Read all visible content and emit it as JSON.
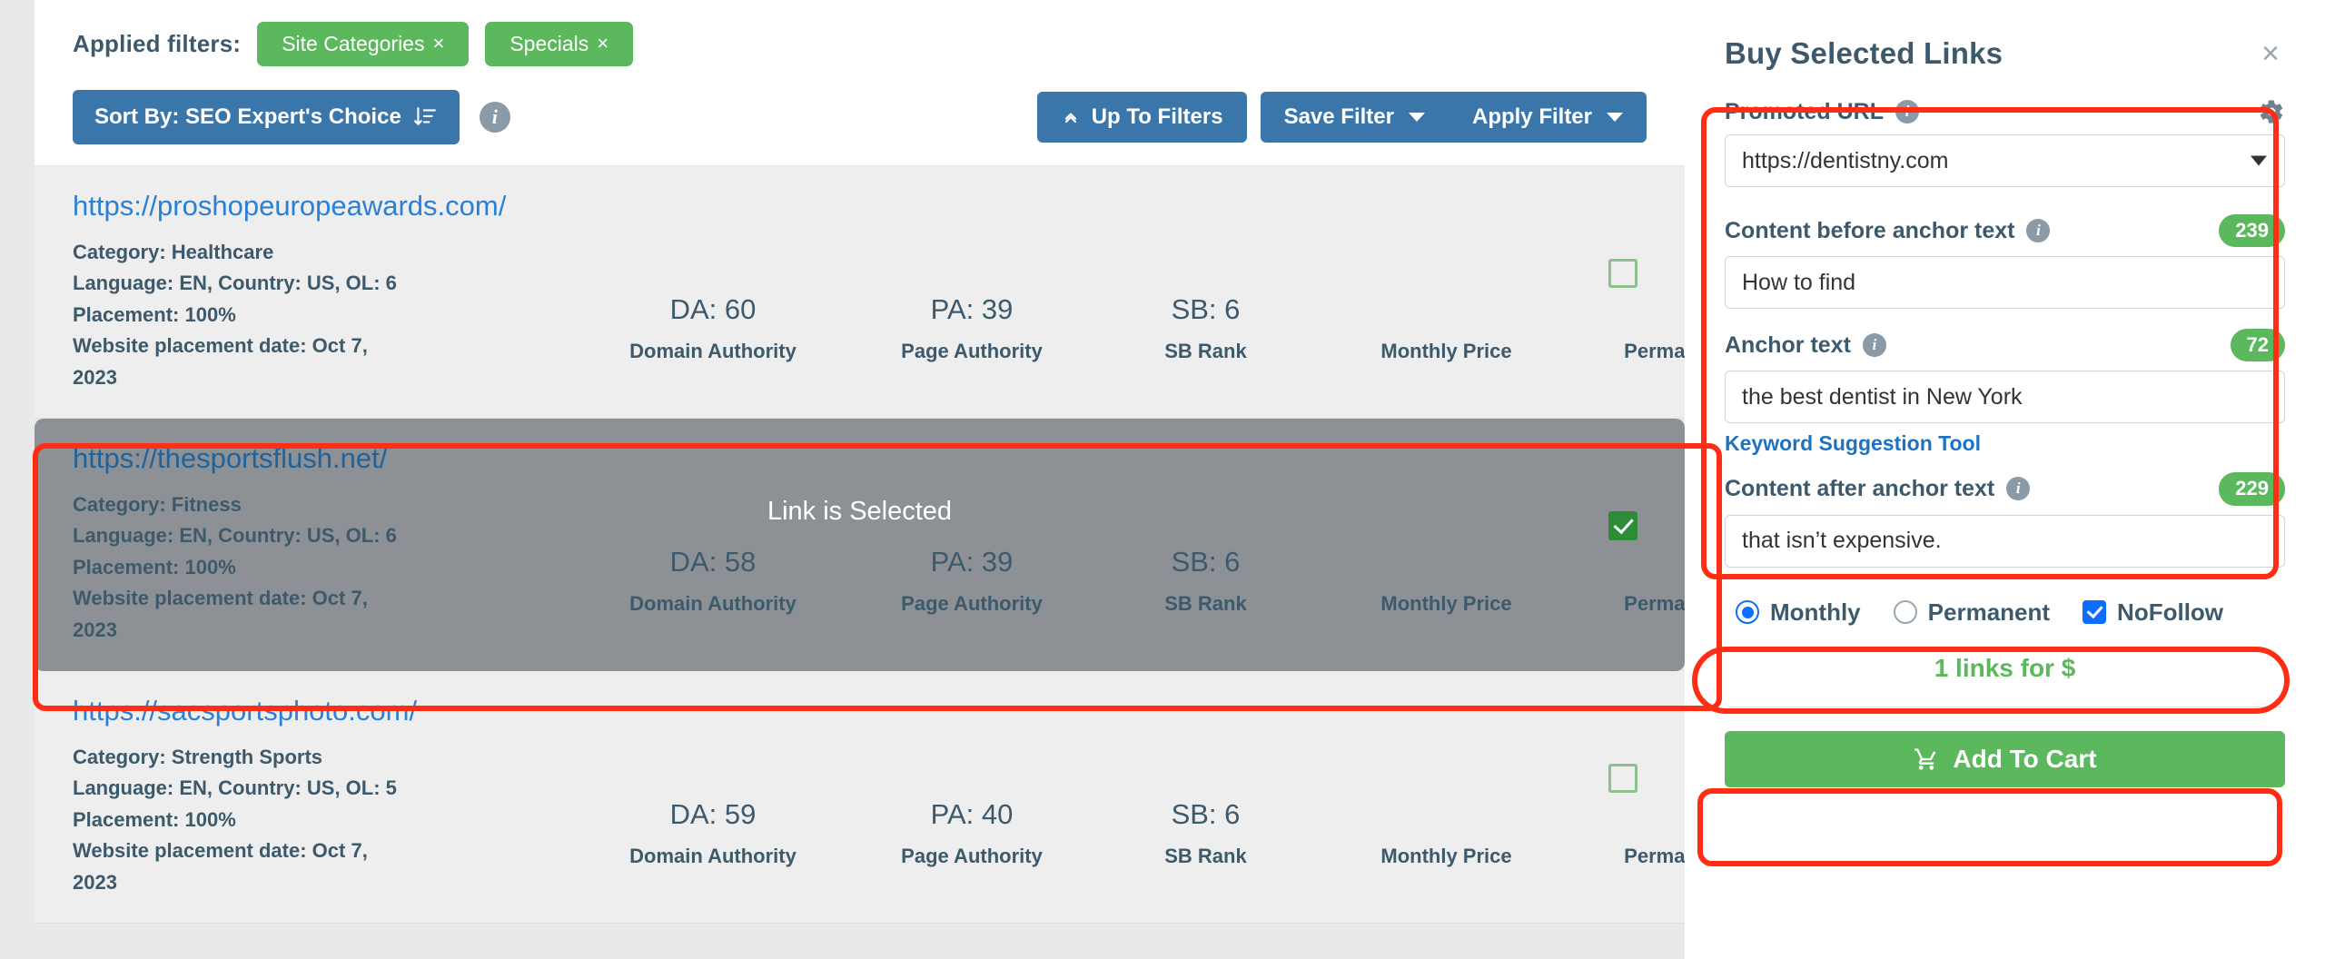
{
  "filters": {
    "applied_label": "Applied filters:",
    "chips": [
      {
        "label": "Site Categories",
        "close": "×"
      },
      {
        "label": "Specials",
        "close": "×"
      }
    ],
    "sort_button": "Sort By: SEO Expert's Choice",
    "sort_info_icon": "info-icon",
    "up_to_filters": "Up To Filters",
    "save_filter": "Save Filter",
    "apply_filter": "Apply Filter"
  },
  "columns": {
    "da": "Domain Authority",
    "pa": "Page Authority",
    "sb": "SB Rank",
    "monthly": "Monthly Price",
    "permanent": "Permanent Price"
  },
  "selected_banner": "Link is Selected",
  "listings": [
    {
      "url": "https://proshopeuropeawards.com/",
      "category": "Category: Healthcare",
      "language": "Language: EN, Country: US, OL: 6",
      "placement": "Placement: 100%",
      "date_line1": "Website placement date: Oct 7,",
      "date_line2": "2023",
      "da": "DA: 60",
      "pa": "PA: 39",
      "sb": "SB: 6",
      "monthly": "",
      "permanent": "",
      "selected": false
    },
    {
      "url": "https://thesportsflush.net/",
      "category": "Category: Fitness",
      "language": "Language: EN, Country: US, OL: 6",
      "placement": "Placement: 100%",
      "date_line1": "Website placement date: Oct 7,",
      "date_line2": "2023",
      "da": "DA: 58",
      "pa": "PA: 39",
      "sb": "SB: 6",
      "monthly": "",
      "permanent": "",
      "selected": true
    },
    {
      "url": "https://sacsportsphoto.com/",
      "category": "Category: Strength Sports",
      "language": "Language: EN, Country: US, OL: 5",
      "placement": "Placement: 100%",
      "date_line1": "Website placement date: Oct 7,",
      "date_line2": "2023",
      "da": "DA: 59",
      "pa": "PA: 40",
      "sb": "SB: 6",
      "monthly": "",
      "permanent": "",
      "selected": false
    }
  ],
  "sidebar": {
    "title": "Buy Selected Links",
    "close_icon": "×",
    "promoted_url": {
      "label": "Promoted URL",
      "info_icon": "info-icon",
      "gear_icon": "gear-icon",
      "value": "https://dentistny.com"
    },
    "content_before": {
      "label": "Content before anchor text",
      "info_icon": "info-icon",
      "badge": "239",
      "value": "How to find"
    },
    "anchor_text": {
      "label": "Anchor text",
      "info_icon": "info-icon",
      "badge": "72",
      "value": "the best dentist in New York",
      "keyword_tool": "Keyword Suggestion Tool"
    },
    "content_after": {
      "label": "Content after anchor text",
      "info_icon": "info-icon",
      "badge": "229",
      "value": "that isn’t expensive."
    },
    "options": {
      "monthly": "Monthly",
      "permanent": "Permanent",
      "nofollow": "NoFollow"
    },
    "links_for": "1 links for $",
    "add_to_cart": "Add To Cart",
    "cart_icon": "shopping-cart-icon"
  },
  "colors": {
    "green": "#5cb85c",
    "blue": "#3b76ab",
    "link_blue": "#2b7fd4",
    "slate": "#3d5a6c",
    "highlight_red": "#ff2d13",
    "selected_row_bg": "#8d9196"
  }
}
